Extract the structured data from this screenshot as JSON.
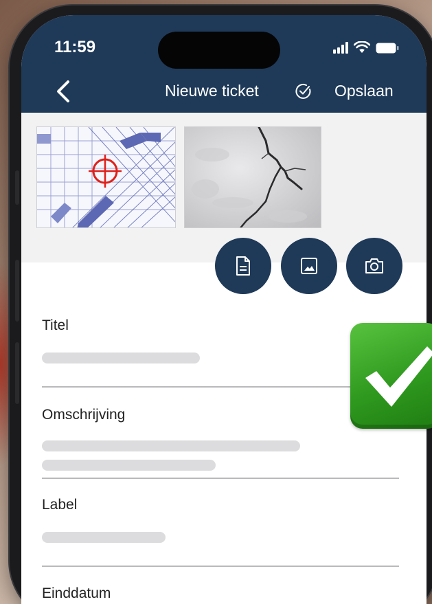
{
  "status_bar": {
    "time": "11:59"
  },
  "nav": {
    "title": "Nieuwe ticket",
    "save_label": "Opslaan"
  },
  "attachments": {
    "thumbnails": [
      "floor-plan",
      "crack-photo"
    ],
    "actions": [
      "document-icon",
      "image-icon",
      "camera-icon"
    ]
  },
  "form": {
    "titel_label": "Titel",
    "omschrijving_label": "Omschrijving",
    "label_label": "Label",
    "einddatum_label": "Einddatum"
  },
  "colors": {
    "header": "#1f3a58",
    "action_button": "#1f3a58",
    "placeholder": "#dcdcde",
    "check_badge": "#3aa82a"
  },
  "overlay": {
    "icon": "check-mark-icon"
  }
}
